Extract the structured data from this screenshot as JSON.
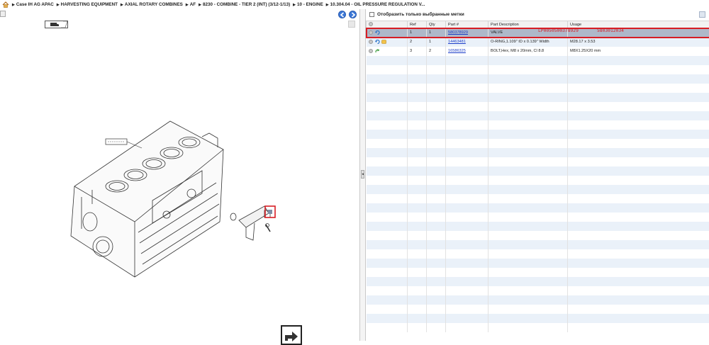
{
  "breadcrumb": [
    "Case IH AG APAC",
    "HARVESTING EQUIPMENT",
    "AXIAL ROTARY COMBINES",
    "AF",
    "8230 - COMBINE - TIER 2 (INT) (3/12-1/13)",
    "10 - ENGINE",
    "10.304.04 - OIL PRESSURE REGULATION V..."
  ],
  "icons": {
    "home": "home-icon",
    "prev": "arrow-left-icon",
    "next": "arrow-right-icon",
    "export": "export-icon"
  },
  "filter_label": "Отобразить только выбранные метки",
  "columns": {
    "ref": "Ref",
    "qty": "Qty",
    "part": "Part #",
    "desc": "Part Description",
    "usage": "Usage"
  },
  "rows": [
    {
      "ref": "1",
      "qty": "1",
      "part": "580378929",
      "desc": "VALVE",
      "usage": "",
      "selected": true
    },
    {
      "ref": "2",
      "qty": "1",
      "part": "14463481",
      "desc": "O-RING,1.109\" ID x 0.139\" Width",
      "usage": "M28.17 x 3.53",
      "selected": false
    },
    {
      "ref": "3",
      "qty": "2",
      "part": "16586325",
      "desc": "BOLT,Hex, M8 x 20mm, Cl 8.8",
      "usage": "M8X1.25X20 mm",
      "selected": false
    }
  ],
  "overlay_codes": [
    "LP0050500378929",
    "5803012034"
  ],
  "colors": {
    "selection_outline": "#d71d24",
    "selected_row": "#aeb8c9",
    "link": "#1a3cc8"
  }
}
